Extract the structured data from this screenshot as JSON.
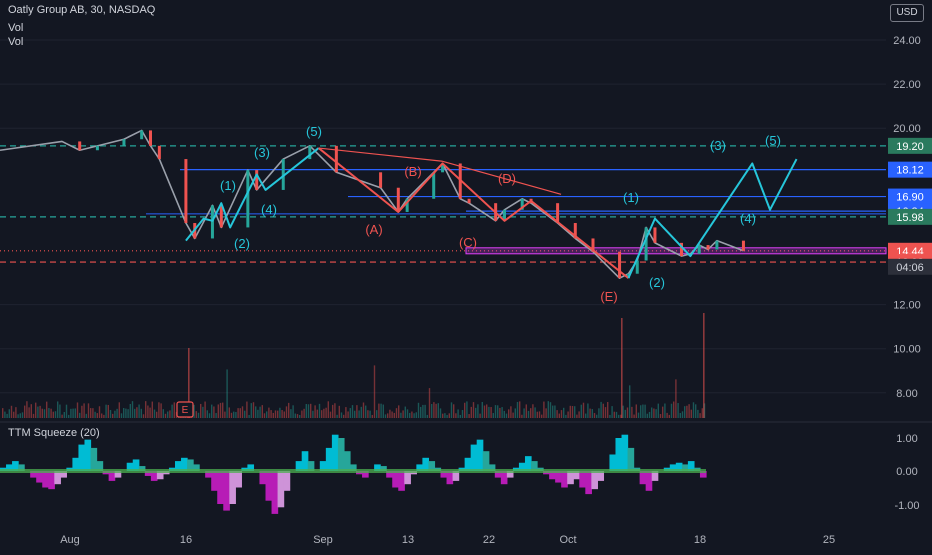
{
  "header": {
    "symbol": "Oatly Group AB, 30, NASDAQ",
    "vol1": "Vol",
    "vol2": "Vol",
    "currency": "USD"
  },
  "indicator": {
    "label": "TTM Squeeze (20)",
    "ticks": [
      "1.00",
      "0.00",
      "-1.00"
    ]
  },
  "colors": {
    "bg": "#131722",
    "up": "#26a69a",
    "down": "#ef5350",
    "wave_cyan": "#26c6da",
    "corr_red": "#ef5350",
    "blue_line": "#2962ff",
    "teal_dash": "#26a69a",
    "magenta": "#e040fb"
  },
  "chart_data": {
    "type": "line",
    "title": "Oatly Group AB, 30, NASDAQ",
    "xlabel": "",
    "ylabel": "",
    "ylim": [
      6.5,
      24.5
    ],
    "y_ticks": [
      "24.00",
      "22.00",
      "20.00",
      "12.00",
      "10.00",
      "8.00"
    ],
    "x_ticks": [
      "Aug",
      "16",
      "Sep",
      "13",
      "22",
      "Oct",
      "18",
      "25"
    ],
    "price_path": [
      {
        "x": "Aug 02",
        "y": 19.4
      },
      {
        "x": "Aug 04",
        "y": 19.0
      },
      {
        "x": "Aug 06",
        "y": 19.2
      },
      {
        "x": "Aug 09",
        "y": 19.5
      },
      {
        "x": "Aug 11",
        "y": 19.9
      },
      {
        "x": "Aug 12",
        "y": 19.2
      },
      {
        "x": "Aug 13",
        "y": 18.6
      },
      {
        "x": "Aug 16",
        "y": 15.7
      },
      {
        "x": "Aug 17",
        "y": 15.0
      },
      {
        "x": "Aug 19",
        "y": 16.5
      },
      {
        "x": "Aug 20",
        "y": 15.5
      },
      {
        "x": "Aug 23",
        "y": 18.1
      },
      {
        "x": "Aug 24",
        "y": 17.2
      },
      {
        "x": "Aug 27",
        "y": 18.6
      },
      {
        "x": "Aug 30",
        "y": 19.2
      },
      {
        "x": "Sep 02",
        "y": 18.0
      },
      {
        "x": "Sep 07",
        "y": 17.3
      },
      {
        "x": "Sep 09",
        "y": 16.2
      },
      {
        "x": "Sep 10",
        "y": 16.8
      },
      {
        "x": "Sep 13",
        "y": 18.0
      },
      {
        "x": "Sep 14",
        "y": 18.4
      },
      {
        "x": "Sep 16",
        "y": 16.8
      },
      {
        "x": "Sep 17",
        "y": 16.6
      },
      {
        "x": "Sep 20",
        "y": 15.8
      },
      {
        "x": "Sep 21",
        "y": 16.3
      },
      {
        "x": "Sep 23",
        "y": 16.8
      },
      {
        "x": "Sep 24",
        "y": 16.6
      },
      {
        "x": "Sep 27",
        "y": 15.7
      },
      {
        "x": "Sep 29",
        "y": 15.0
      },
      {
        "x": "Oct 01",
        "y": 14.4
      },
      {
        "x": "Oct 04",
        "y": 13.2
      },
      {
        "x": "Oct 05",
        "y": 13.4
      },
      {
        "x": "Oct 06",
        "y": 14.0
      },
      {
        "x": "Oct 07",
        "y": 15.5
      },
      {
        "x": "Oct 08",
        "y": 14.8
      },
      {
        "x": "Oct 11",
        "y": 14.2
      },
      {
        "x": "Oct 12",
        "y": 14.3
      },
      {
        "x": "Oct 13",
        "y": 14.7
      },
      {
        "x": "Oct 14",
        "y": 14.5
      },
      {
        "x": "Oct 15",
        "y": 14.9
      },
      {
        "x": "Oct 18",
        "y": 14.44
      }
    ],
    "impulse_wave": {
      "labels": [
        "(1)",
        "(2)",
        "(3)",
        "(4)",
        "(5)"
      ],
      "points": [
        {
          "x": "Aug 16",
          "y": 14.9
        },
        {
          "x": "Aug 18",
          "y": 15.9
        },
        {
          "x": "Aug 19",
          "y": 15.8
        },
        {
          "x": "Aug 20",
          "y": 16.6
        },
        {
          "x": "Aug 21",
          "y": 15.5
        },
        {
          "x": "Aug 24",
          "y": 17.9
        },
        {
          "x": "Aug 25",
          "y": 17.2
        },
        {
          "x": "Aug 31",
          "y": 19.1
        }
      ]
    },
    "correction_wave": {
      "labels": [
        "(A)",
        "(B)",
        "(C)",
        "(D)",
        "(E)"
      ],
      "points": [
        {
          "x": "Aug 31",
          "y": 19.1
        },
        {
          "x": "Sep 09",
          "y": 16.2
        },
        {
          "x": "Sep 14",
          "y": 18.4
        },
        {
          "x": "Sep 21",
          "y": 15.8
        },
        {
          "x": "Sep 24",
          "y": 16.7
        },
        {
          "x": "Oct 05",
          "y": 13.2
        }
      ]
    },
    "projection_wave": {
      "labels": [
        "(1)",
        "(2)",
        "(3)",
        "(4)",
        "(5)"
      ],
      "points": [
        {
          "x": "Oct 05",
          "y": 13.2
        },
        {
          "x": "Oct 08",
          "y": 15.9
        },
        {
          "x": "Oct 12",
          "y": 14.2
        },
        {
          "x": "Oct 19",
          "y": 18.4
        },
        {
          "x": "Oct 21",
          "y": 16.3
        },
        {
          "x": "Oct 24",
          "y": 18.6
        }
      ]
    },
    "levels": [
      {
        "value": 19.2,
        "label": "19.20",
        "style": "dashed",
        "color": "#26a69a"
      },
      {
        "value": 18.12,
        "label": "18.12",
        "style": "solid",
        "color": "#2962ff"
      },
      {
        "value": 16.9,
        "label": "16.90",
        "style": "solid",
        "color": "#2962ff"
      },
      {
        "value": 16.24,
        "label": "16.24",
        "style": "solid",
        "color": "#2962ff"
      },
      {
        "value": 15.98,
        "label": "15.98",
        "style": "dashed",
        "color": "#26a69a"
      },
      {
        "value": 14.44,
        "label": "14.44",
        "style": "dotted",
        "color": "#ef5350"
      },
      {
        "value": 13.93,
        "label": "13.93",
        "style": "dashed",
        "color": "#ef5350"
      }
    ],
    "countdown": "04:06",
    "earnings_marker": "E",
    "squeeze_histogram": {
      "ylim": [
        -1.4,
        1.4
      ],
      "values": [
        0.1,
        0.2,
        0.3,
        0.2,
        0.0,
        -0.2,
        -0.35,
        -0.5,
        -0.55,
        -0.4,
        -0.2,
        0.1,
        0.4,
        0.8,
        0.95,
        0.7,
        0.3,
        -0.1,
        -0.3,
        -0.2,
        0.0,
        0.25,
        0.35,
        0.15,
        -0.15,
        -0.3,
        -0.25,
        -0.1,
        0.1,
        0.3,
        0.4,
        0.35,
        0.2,
        0.0,
        -0.2,
        -0.6,
        -1.0,
        -1.2,
        -1.0,
        -0.5,
        0.1,
        0.2,
        0.0,
        -0.4,
        -0.9,
        -1.3,
        -1.1,
        -0.6,
        0.0,
        0.3,
        0.6,
        0.3,
        0.0,
        0.3,
        0.7,
        1.1,
        1.0,
        0.6,
        0.2,
        -0.1,
        -0.2,
        0.0,
        0.2,
        0.15,
        -0.2,
        -0.5,
        -0.6,
        -0.4,
        -0.1,
        0.2,
        0.4,
        0.3,
        0.1,
        -0.2,
        -0.4,
        -0.3,
        0.1,
        0.4,
        0.8,
        0.95,
        0.6,
        0.2,
        -0.2,
        -0.4,
        -0.2,
        0.1,
        0.25,
        0.45,
        0.3,
        0.1,
        -0.1,
        -0.25,
        -0.35,
        -0.5,
        -0.4,
        -0.25,
        -0.5,
        -0.7,
        -0.55,
        -0.3,
        0.0,
        0.5,
        1.0,
        1.1,
        0.7,
        0.1,
        -0.4,
        -0.6,
        -0.3,
        0.0,
        0.1,
        0.2,
        0.25,
        0.2,
        0.3,
        0.1,
        -0.2
      ]
    }
  }
}
